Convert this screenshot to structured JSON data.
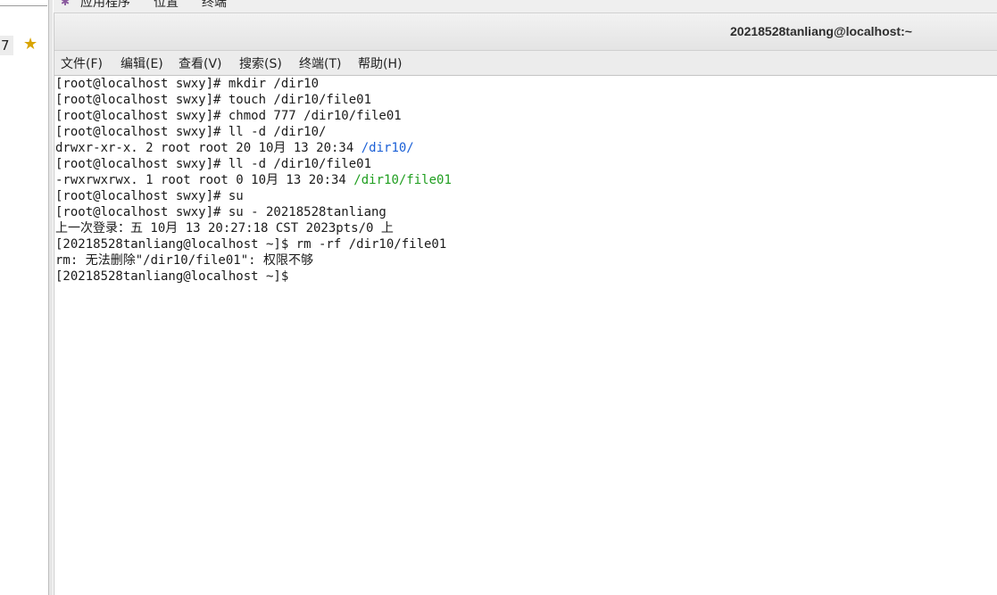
{
  "left_window": {
    "number": "7",
    "star_icon": "star-icon"
  },
  "system_menu": {
    "applications": "应用程序",
    "places": "位置",
    "terminal": "终端"
  },
  "terminal": {
    "title": "20218528tanliang@localhost:~",
    "menu": {
      "file": "文件(F)",
      "edit": "编辑(E)",
      "view": "查看(V)",
      "search": "搜索(S)",
      "terminal": "终端(T)",
      "help": "帮助(H)"
    },
    "lines": [
      {
        "text": "[root@localhost swxy]# mkdir /dir10"
      },
      {
        "text": "[root@localhost swxy]# touch /dir10/file01"
      },
      {
        "text": "[root@localhost swxy]# chmod 777 /dir10/file01"
      },
      {
        "text": "[root@localhost swxy]# ll -d /dir10/"
      },
      {
        "text": "drwxr-xr-x. 2 root root 20 10月 13 20:34 ",
        "colored": "/dir10/",
        "color": "#1a5fd6"
      },
      {
        "text": "[root@localhost swxy]# ll -d /dir10/file01"
      },
      {
        "text": "-rwxrwxrwx. 1 root root 0 10月 13 20:34 ",
        "colored": "/dir10/file01",
        "color": "#1f9e1f"
      },
      {
        "text": "[root@localhost swxy]# su"
      },
      {
        "text": "[root@localhost swxy]# su - 20218528tanliang"
      },
      {
        "text": "上一次登录：五 10月 13 20:27:18 CST 2023pts/0 上"
      },
      {
        "text": "[20218528tanliang@localhost ~]$ rm -rf /dir10/file01"
      },
      {
        "text": "rm: 无法删除\"/dir10/file01\": 权限不够"
      },
      {
        "text": "[20218528tanliang@localhost ~]$ "
      }
    ]
  }
}
